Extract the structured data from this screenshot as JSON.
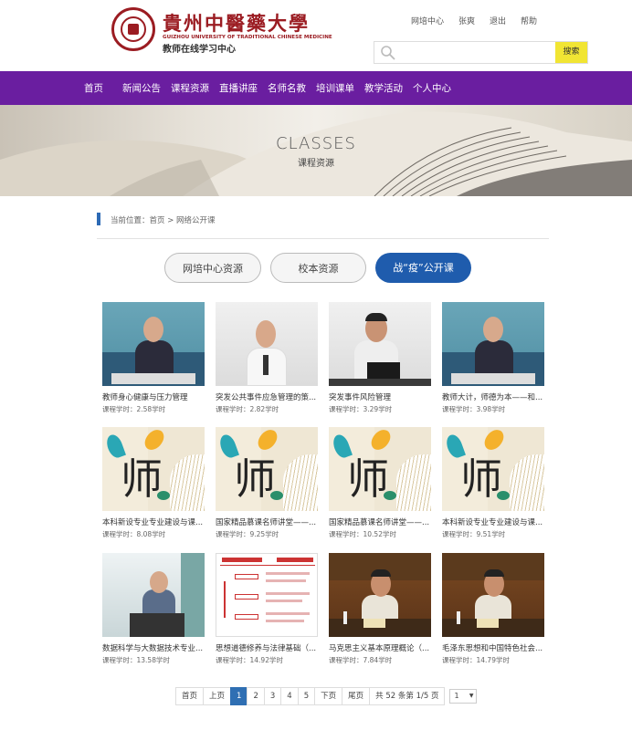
{
  "header": {
    "logo_cn": "貴州中醫藥大學",
    "logo_en": "GUIZHOU UNIVERSITY OF TRADITIONAL CHINESE MEDICINE",
    "logo_sub": "教师在线学习中心",
    "links": [
      "网培中心",
      "张爽",
      "退出",
      "帮助"
    ],
    "search_placeholder": "",
    "search_button": "搜索"
  },
  "nav": [
    "首页",
    "新闻公告",
    "课程资源",
    "直播讲座",
    "名师名教",
    "培训课单",
    "教学活动",
    "个人中心"
  ],
  "banner": {
    "en": "CLASSES",
    "cn": "课程资源"
  },
  "breadcrumb": "当前位置：首页 > 网络公开课",
  "tabs": [
    {
      "label": "网培中心资源",
      "active": false
    },
    {
      "label": "校本资源",
      "active": false
    },
    {
      "label": "战“疫”公开课",
      "active": true
    }
  ],
  "courses": [
    {
      "title": "教师身心健康与压力管理",
      "hours": "课程学时：2.58学时",
      "thumb": "video-blue"
    },
    {
      "title": "突发公共事件应急管理的策...",
      "hours": "课程学时：2.82学时",
      "thumb": "video-light"
    },
    {
      "title": "突发事件风险管理",
      "hours": "课程学时：3.29学时",
      "thumb": "video-light-desk"
    },
    {
      "title": "教师大计，师德为本——和...",
      "hours": "课程学时：3.98学时",
      "thumb": "video-blue"
    },
    {
      "title": "本科新设专业专业建设与课...",
      "hours": "课程学时：8.08学时",
      "thumb": "shi"
    },
    {
      "title": "国家精品慕课名师讲堂——...",
      "hours": "课程学时：9.25学时",
      "thumb": "shi"
    },
    {
      "title": "国家精品慕课名师讲堂——...",
      "hours": "课程学时：10.52学时",
      "thumb": "shi"
    },
    {
      "title": "本科新设专业专业建设与课...",
      "hours": "课程学时：9.51学时",
      "thumb": "shi"
    },
    {
      "title": "数据科学与大数据技术专业...",
      "hours": "课程学时：13.58学时",
      "thumb": "video-podium"
    },
    {
      "title": "思想道德修养与法律基础（...",
      "hours": "课程学时：14.92学时",
      "thumb": "slide"
    },
    {
      "title": "马克思主义基本原理概论（...",
      "hours": "课程学时：7.84学时",
      "thumb": "wood"
    },
    {
      "title": "毛泽东思想和中国特色社会...",
      "hours": "课程学时：14.79学时",
      "thumb": "wood"
    }
  ],
  "pager": {
    "first": "首页",
    "prev": "上页",
    "pages": [
      "1",
      "2",
      "3",
      "4",
      "5"
    ],
    "current": "1",
    "next": "下页",
    "last": "尾页",
    "info": "共 52 条第 1/5 页",
    "select": "1"
  },
  "colors": {
    "nav": "#6a1ea0",
    "accent": "#1f5cad",
    "brand": "#9b1c22",
    "search_btn": "#f1e533"
  }
}
